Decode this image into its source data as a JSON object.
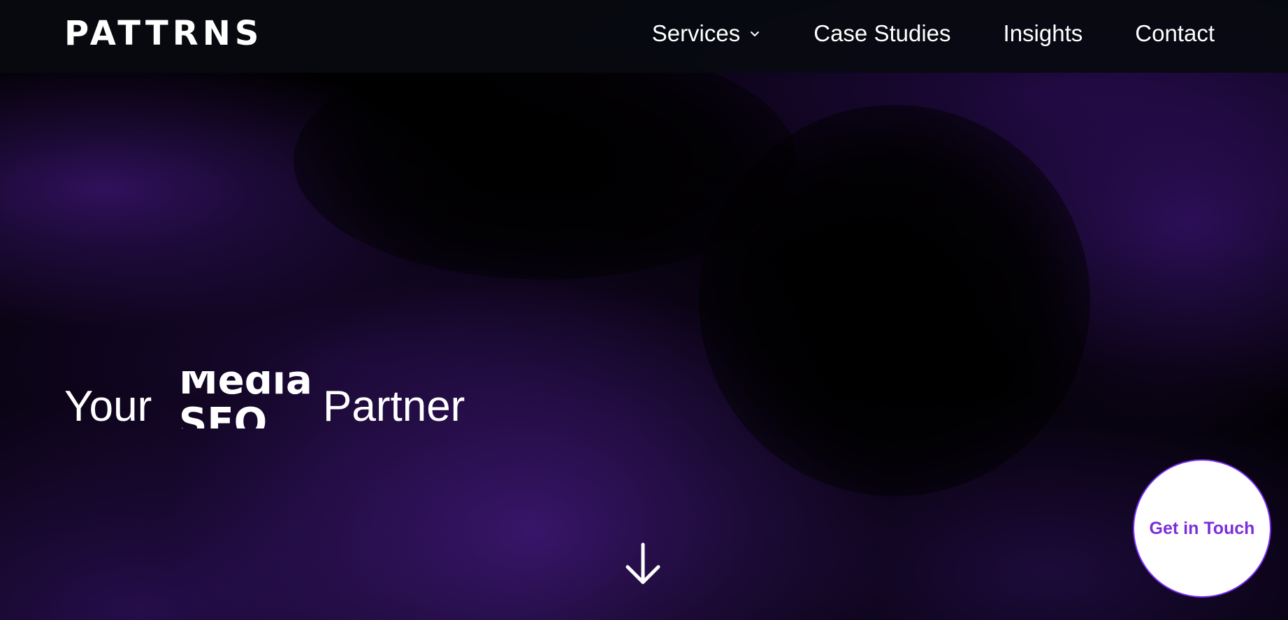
{
  "header": {
    "logo_text": "PATTRNS",
    "nav": [
      {
        "label": "Services",
        "has_dropdown": true
      },
      {
        "label": "Case Studies"
      },
      {
        "label": "Insights"
      },
      {
        "label": "Contact"
      }
    ]
  },
  "hero": {
    "prefix": "Your",
    "rotating_words": [
      "Media",
      "SEO"
    ],
    "suffix": "Partner"
  },
  "icons": {
    "scroll": "arrow-down-icon",
    "dropdown": "chevron-down-icon"
  },
  "cta": {
    "label": "Get in Touch"
  },
  "colors": {
    "accent": "#7b2fd8",
    "background": "#000000",
    "glow": "#3a166e"
  }
}
